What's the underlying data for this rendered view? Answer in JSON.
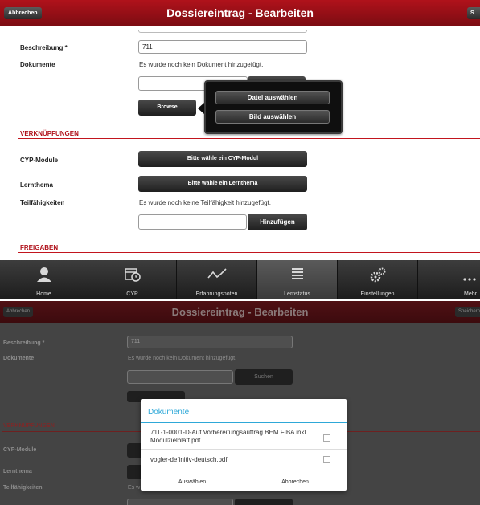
{
  "screen1": {
    "header": {
      "cancel_label": "Abbrechen",
      "title": "Dossiereintrag - Bearbeiten",
      "save_label_partial": "S"
    },
    "form": {
      "beschreibung_label": "Beschreibung *",
      "beschreibung_value": "711",
      "dokumente_label": "Dokumente",
      "dokumente_status": "Es wurde noch kein Dokument hinzugefügt.",
      "browse_label": "Browse"
    },
    "popup": {
      "file_select_label": "Datei auswählen",
      "image_select_label": "Bild auswählen"
    },
    "verknuepfungen": {
      "section_title": "VERKNÜPFUNGEN",
      "cyp_label": "CYP-Module",
      "cyp_button": "Bitte wähle ein CYP-Modul",
      "lernthema_label": "Lernthema",
      "lernthema_button": "Bitte wähle ein Lernthema",
      "teilfaehigkeiten_label": "Teilfähigkeiten",
      "teilfaehigkeiten_status": "Es wurde noch keine Teilfähigkeit hinzugefügt.",
      "add_button": "Hinzufügen"
    },
    "freigaben": {
      "section_title": "FREIGABEN"
    },
    "tabbar": {
      "tabs": [
        {
          "label": "Home",
          "icon": "person-icon"
        },
        {
          "label": "CYP",
          "icon": "calendar-clock-icon"
        },
        {
          "label": "Erfahrungsnoten",
          "icon": "line-chart-icon"
        },
        {
          "label": "Lernstatus",
          "icon": "list-icon"
        },
        {
          "label": "Einstellungen",
          "icon": "gears-icon"
        },
        {
          "label": "Mehr",
          "icon": "more-dots-icon"
        }
      ],
      "active_tab": "Lernstatus"
    }
  },
  "screen2": {
    "header": {
      "cancel_label": "Abbrechen",
      "title": "Dossiereintrag - Bearbeiten",
      "save_label": "Speichern"
    },
    "form": {
      "beschreibung_label": "Beschreibung *",
      "beschreibung_value": "711",
      "dokumente_label": "Dokumente",
      "dokumente_status": "Es wurde noch kein Dokument hinzugefügt.",
      "search_button": "Suchen",
      "verknuepfungen_title": "VERKNÜPFUNGEN",
      "cyp_label": "CYP-Module",
      "lernthema_label": "Lernthema",
      "teilfaehigkeiten_label": "Teilfähigkeiten",
      "teilfaehigkeiten_status_partial": "Es w"
    },
    "dialog": {
      "title": "Dokumente",
      "items": [
        {
          "name_line1": "711-1-0001-D-Auf Vorbereitungsauftrag BEM FIBA inkl",
          "name_line2": "Modulzielblatt.pdf",
          "checked": false
        },
        {
          "name_line1": "vogler-definitiv-deutsch.pdf",
          "name_line2": "",
          "checked": false
        }
      ],
      "select_button": "Auswählen",
      "cancel_button": "Abbrechen"
    }
  },
  "colors": {
    "brand_red": "#b0121b",
    "dialog_accent": "#2ea8d8"
  }
}
